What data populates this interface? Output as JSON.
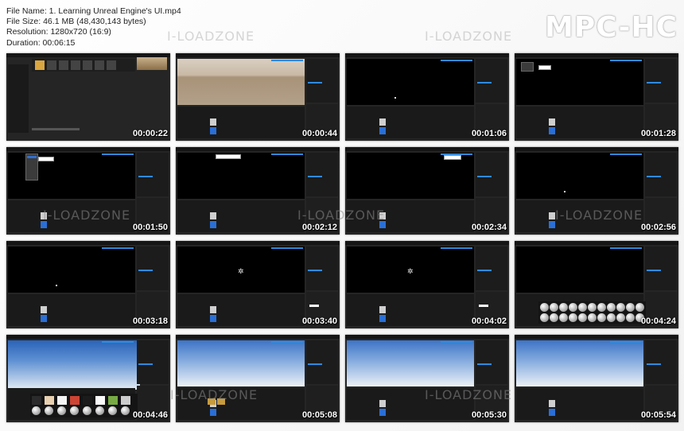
{
  "file_info": {
    "name": "File Name: 1. Learning Unreal Engine's UI.mp4",
    "size": "File Size: 46.1 MB (48,430,143 bytes)",
    "resolution": "Resolution: 1280x720 (16:9)",
    "duration": "Duration: 00:06:15"
  },
  "logo": "MPC-HC",
  "watermark": "I-LOADZONE",
  "thumbnails": [
    {
      "time": "00:00:22",
      "scene": "project-browser"
    },
    {
      "time": "00:00:44",
      "scene": "desert-viewport"
    },
    {
      "time": "00:01:06",
      "scene": "black-viewport"
    },
    {
      "time": "00:01:28",
      "scene": "menu-open"
    },
    {
      "time": "00:01:50",
      "scene": "dropdown-menu"
    },
    {
      "time": "00:02:12",
      "scene": "tooltip"
    },
    {
      "time": "00:02:34",
      "scene": "tooltip-right"
    },
    {
      "time": "00:02:56",
      "scene": "black-viewport"
    },
    {
      "time": "00:03:18",
      "scene": "black-viewport"
    },
    {
      "time": "00:03:40",
      "scene": "light-icon"
    },
    {
      "time": "00:04:02",
      "scene": "light-icon"
    },
    {
      "time": "00:04:24",
      "scene": "place-actors"
    },
    {
      "time": "00:04:46",
      "scene": "sky-materials"
    },
    {
      "time": "00:05:08",
      "scene": "sky"
    },
    {
      "time": "00:05:30",
      "scene": "sky"
    },
    {
      "time": "00:05:54",
      "scene": "sky"
    }
  ]
}
